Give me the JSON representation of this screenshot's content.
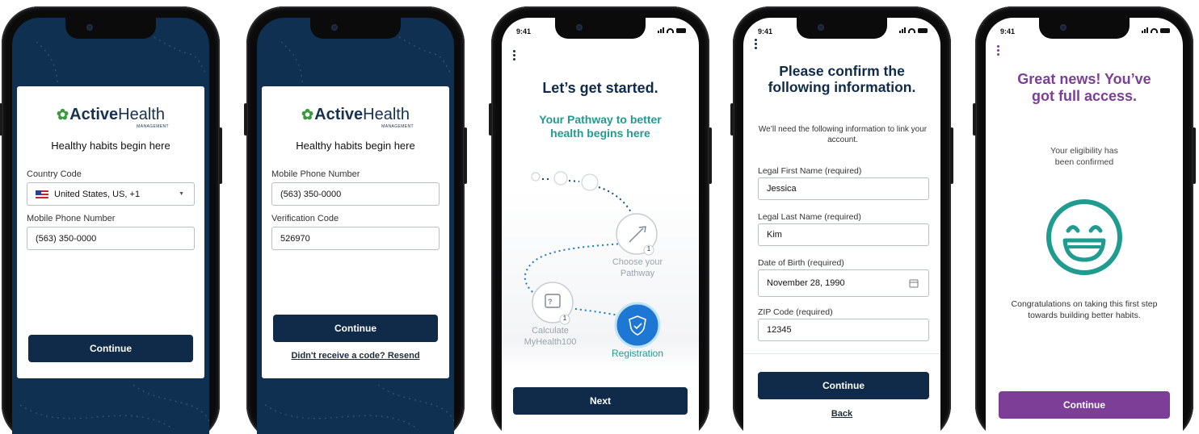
{
  "brand": {
    "logo_prefix": "Active",
    "logo_suffix": "Health",
    "logo_sub": "MANAGEMENT",
    "tagline": "Healthy habits begin here",
    "colors": {
      "navy": "#0f2b49",
      "dark_bg": "#0f3050",
      "teal": "#1f9c8f",
      "purple": "#7c3e97",
      "accent_blue": "#1e77d3"
    }
  },
  "screen1": {
    "country_label": "Country Code",
    "country_value": "United States, US, +1",
    "phone_label": "Mobile Phone Number",
    "phone_value": "(563) 350-0000",
    "continue": "Continue"
  },
  "screen2": {
    "phone_label": "Mobile Phone Number",
    "phone_value": "(563) 350-0000",
    "code_label": "Verification Code",
    "code_value": "526970",
    "continue": "Continue",
    "resend": "Didn't receive a code? Resend"
  },
  "screen3": {
    "time": "9:41",
    "title": "Let’s get started.",
    "subtitle": "Your Pathway to better health begins here",
    "step_choose": "Choose your Pathway",
    "step_calc": "Calculate MyHealth100",
    "step_reg": "Registration",
    "badge1": "1",
    "badge2": "1",
    "next": "Next"
  },
  "screen4": {
    "time": "9:41",
    "title": "Please confirm the following information.",
    "intro": "We’ll need the following information to link your account.",
    "first_label": "Legal First Name (required)",
    "first_value": "Jessica",
    "last_label": "Legal Last Name (required)",
    "last_value": "Kim",
    "dob_label": "Date of Birth (required)",
    "dob_value": "November 28, 1990",
    "zip_label": "ZIP Code (required)",
    "zip_value": "12345",
    "continue": "Continue",
    "back": "Back"
  },
  "screen5": {
    "time": "9:41",
    "title": "Great news! You’ve got full access.",
    "eligibility": "Your eligibility has been confirmed",
    "congrats": "Congratulations on taking this first step towards building better habits.",
    "continue": "Continue"
  }
}
